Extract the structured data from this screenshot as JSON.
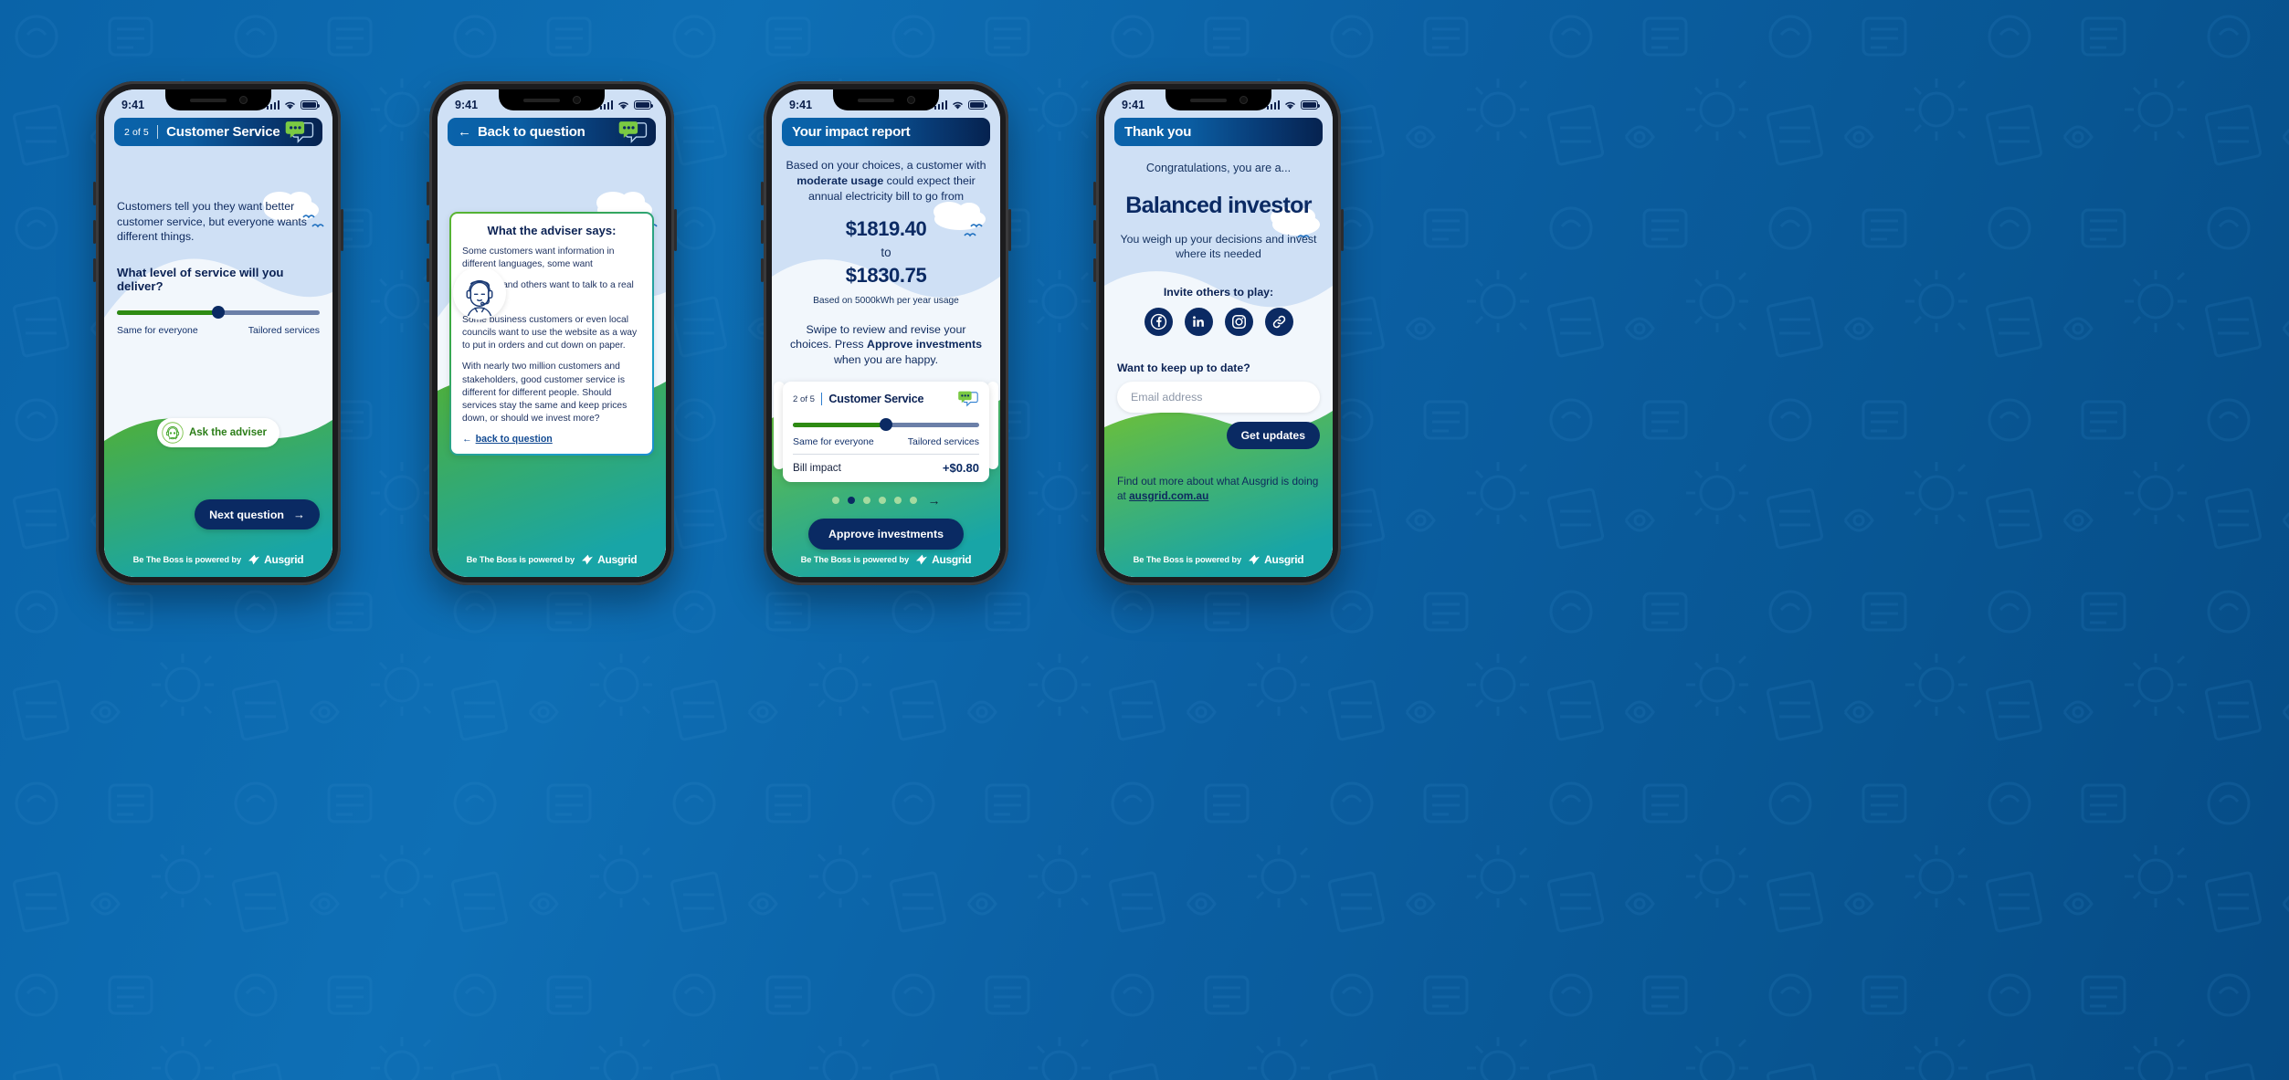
{
  "background": {
    "accent_blue": "#0a63a8",
    "deep_navy": "#0b2a63",
    "green": "#4FAF3A",
    "teal": "#18A5A7"
  },
  "statusbar": {
    "time": "9:41",
    "signal_icon": "cellular-bars-icon",
    "wifi_icon": "wifi-icon",
    "battery_icon": "battery-icon"
  },
  "footer": {
    "powered_by": "Be The Boss is powered by",
    "brand": "Ausgrid"
  },
  "phone1": {
    "header": {
      "step": "2 of 5",
      "title": "Customer Service",
      "chat_icon": "chat-bubbles-icon"
    },
    "body_text": "Customers tell you they want better customer service, but everyone wants different things.",
    "question": "What level of service will you deliver?",
    "slider": {
      "value_percent": 50,
      "left_label": "Same for everyone",
      "right_label": "Tailored services"
    },
    "adviser_button": {
      "label": "Ask the adviser",
      "icon": "adviser-headset-icon"
    },
    "next_button": {
      "label": "Next question",
      "icon": "arrow-right-icon"
    }
  },
  "phone2": {
    "header": {
      "back_label": "Back to question",
      "back_icon": "arrow-left-icon",
      "chat_icon": "chat-bubbles-icon"
    },
    "avatar_icon": "adviser-headset-avatar-icon",
    "card_title": "What the adviser says:",
    "paragraphs": [
      "Some customers want information in different languages, some want",
      "Chatbots and others want to talk to a real person.",
      "Some business customers or even local councils want to use the website as a way to put in orders and cut down on paper.",
      "With nearly two million customers and stakeholders, good customer service is different for different people. Should services stay the same and keep prices down, or should we invest more?"
    ],
    "back_link": "back to question",
    "back_link_icon": "arrow-left-icon"
  },
  "phone3": {
    "header": {
      "title": "Your impact report"
    },
    "intro_before": "Based on your choices, a customer with ",
    "intro_bold": "moderate usage",
    "intro_after": " could expect their annual electricity bill to go from",
    "amount_from": "$1819.40",
    "to_word": "to",
    "amount_to": "$1830.75",
    "basis": "Based on 5000kWh per year usage",
    "swipe_text_1": "Swipe to review and revise your choices. Press ",
    "swipe_bold_1": "Approve investments",
    "swipe_text_2": " when you are happy.",
    "mini_card": {
      "step": "2 of 5",
      "title": "Customer Service",
      "chat_icon": "chat-bubbles-icon",
      "slider": {
        "value_percent": 50,
        "left_label": "Same for everyone",
        "right_label": "Tailored services"
      },
      "bill_label": "Bill impact",
      "bill_value": "+$0.80"
    },
    "pagination": {
      "count": 6,
      "active_index": 1,
      "next_icon": "arrow-right-icon"
    },
    "approve_button": "Approve investments"
  },
  "phone4": {
    "header": {
      "title": "Thank you"
    },
    "congrats": "Congratulations, you are a...",
    "persona": "Balanced investor",
    "persona_desc": "You weigh up your decisions and invest where its needed",
    "invite_label": "Invite others to play:",
    "socials": [
      {
        "name": "facebook-icon"
      },
      {
        "name": "linkedin-icon"
      },
      {
        "name": "instagram-icon"
      },
      {
        "name": "copy-link-icon"
      }
    ],
    "keepup_label": "Want to keep up to date?",
    "email_placeholder": "Email address",
    "get_updates_button": "Get updates",
    "findout_text": "Find out more about what Ausgrid is doing at ",
    "findout_link": "ausgrid.com.au"
  }
}
